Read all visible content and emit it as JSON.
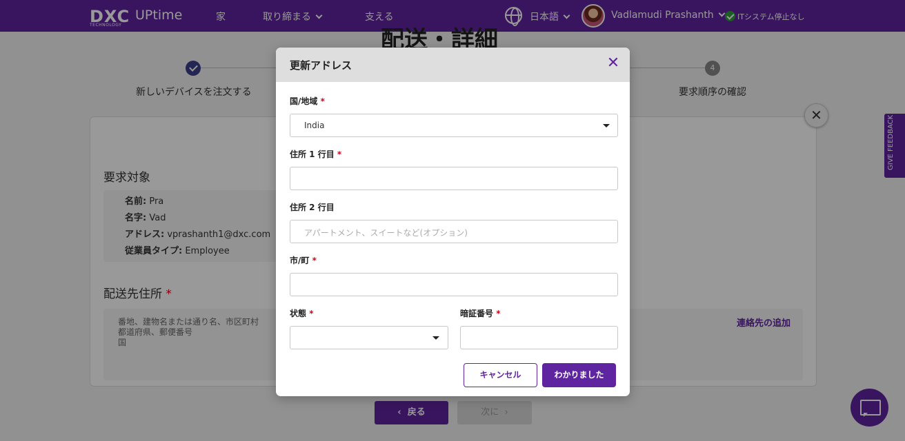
{
  "header": {
    "logo_main": "DXC",
    "logo_sub": "TECHNOLOGY",
    "logo_product": "UPtime",
    "nav_home": "家",
    "nav_order": "取り締まる",
    "nav_support": "支える",
    "language": "日本語",
    "user_name": "Vadlamudi Prashanth",
    "system_status": "ITシステム停止なし"
  },
  "page": {
    "title": "配送・詳細",
    "steps": [
      {
        "label": "新しいデバイスを注文する",
        "state": "done"
      },
      {
        "number": "4",
        "label": "要求順序の確認",
        "state": "pending"
      }
    ],
    "request_section_title": "要求対象",
    "request_info": {
      "first_name_label": "名前:",
      "first_name": "Pra",
      "last_name_label": "名字:",
      "last_name": "Vad",
      "address_label": "アドレス:",
      "address": "vprashanth1@dxc.com",
      "employee_type_label": "従業員タイプ:",
      "employee_type": "Employee"
    },
    "shipping_title": "配送先住所",
    "shipping_required_mark": "*",
    "shipping_hint_lines": [
      "番地、建物名または通り名、市区町村",
      "都道府県、郵便番号",
      "国"
    ],
    "add_contact": "連絡先の追加",
    "back_button": "戻る",
    "next_button": "次に",
    "feedback_tab": "GIVE FEEDBACK"
  },
  "modal": {
    "title": "更新アドレス",
    "required_mark": "*",
    "country_label": "国/地域",
    "country_value": "India",
    "address1_label": "住所 1 行目",
    "address1_value": "",
    "address2_label": "住所 2 行目",
    "address2_placeholder": "アパートメント、スイートなど(オプション)",
    "city_label": "市/町",
    "city_value": "",
    "state_label": "状態",
    "state_value": "",
    "pin_label": "暗証番号",
    "pin_value": "",
    "cancel_button": "キャンセル",
    "ok_button": "わかりました"
  },
  "colors": {
    "brand_purple": "#5f249f",
    "required_red": "#d0021b",
    "status_green": "#2e9b3a"
  }
}
